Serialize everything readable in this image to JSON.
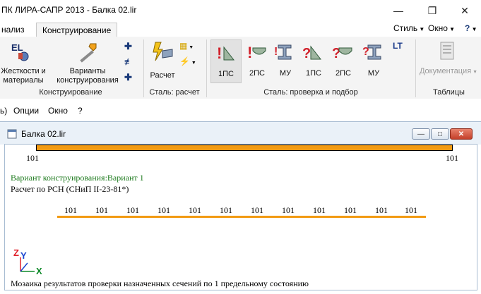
{
  "window": {
    "title": "ПК ЛИРА-САПР  2013 - Балка 02.lir",
    "minimize_glyph": "—",
    "maximize_glyph": "❐",
    "close_glyph": "✕"
  },
  "tabs": {
    "partial_left": "нализ",
    "active": "Конструирование",
    "style_label": "Стиль",
    "window_label": "Окно",
    "help_label": "?"
  },
  "ribbon": {
    "groups": {
      "design": "Конструирование",
      "steel_calc": "Сталь: расчет",
      "steel_check": "Сталь: проверка и подбор",
      "tables": "Таблицы"
    },
    "buttons": {
      "stiffness_line1": "Жесткости и",
      "stiffness_line2": "материалы",
      "variants_line1": "Варианты",
      "variants_line2": "конструирования",
      "calc": "Расчет",
      "check_1ps": "1ПС",
      "check_2ps": "2ПС",
      "check_mu": "МУ",
      "select_1ps": "1ПС",
      "select_2ps": "2ПС",
      "select_mu": "МУ",
      "docs": "Документация"
    },
    "icon_text": {
      "el": "EL",
      "exclaim": "!",
      "question": "?",
      "sect": "I",
      "lt": "LT"
    }
  },
  "menubar": {
    "partial": "ь)",
    "options": "Опции",
    "window": "Окно",
    "help": "?"
  },
  "child": {
    "caption": "Балка 02.lir",
    "min_glyph": "—",
    "max_glyph": "□",
    "close_glyph": "✕"
  },
  "drawing": {
    "top_beam_left_label": "101",
    "top_beam_right_label": "101",
    "variant_text": "Вариант конструирования:Вариант 1",
    "calc_text": "Расчет по РСН (СНиП II-23-81*)",
    "element_labels": [
      "101",
      "101",
      "101",
      "101",
      "101",
      "101",
      "101",
      "101",
      "101",
      "101",
      "101",
      "101"
    ],
    "axis_z": "Z",
    "axis_y": "Y",
    "axis_x": "X",
    "status_text": "Мозаика результатов проверки назначенных сечений по 1 предельному состоянию",
    "colors": {
      "beam_fill": "#f29a12",
      "beam_stroke": "#000000",
      "variant_text": "#1d7a1d",
      "axis_z": "#e0202a",
      "axis_y": "#1a44d0",
      "axis_x": "#0f8a2a"
    }
  }
}
